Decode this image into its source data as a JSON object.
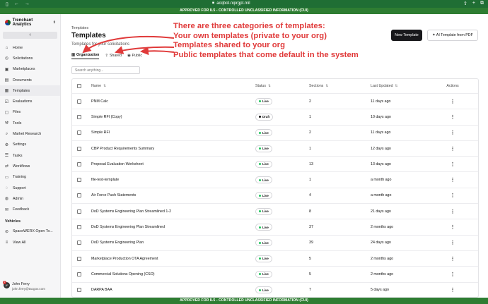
{
  "browser": {
    "url": "acqbot.niprgpt.mil",
    "banner": "APPROVED FOR IL5 - CONTROLLED UNCLASSIFIED INFORMATION (CUI)"
  },
  "sidebar": {
    "org_name": "Trenchant Analytics",
    "items": [
      {
        "label": "Home",
        "icon": "home-icon",
        "glyph": "⌂"
      },
      {
        "label": "Solicitations",
        "icon": "solicitations-icon",
        "glyph": "◎"
      },
      {
        "label": "Marketplaces",
        "icon": "marketplace-icon",
        "glyph": "▣"
      },
      {
        "label": "Documents",
        "icon": "document-icon",
        "glyph": "▤"
      },
      {
        "label": "Templates",
        "icon": "template-icon",
        "glyph": "▦"
      },
      {
        "label": "Evaluations",
        "icon": "evaluation-icon",
        "glyph": "☑"
      },
      {
        "label": "Files",
        "icon": "file-icon",
        "glyph": "▢"
      },
      {
        "label": "Tools",
        "icon": "tools-icon",
        "glyph": "⚒"
      },
      {
        "label": "Market Research",
        "icon": "research-icon",
        "glyph": "⌕"
      },
      {
        "label": "Settings",
        "icon": "gear-icon",
        "glyph": "⚙"
      },
      {
        "label": "Tasks",
        "icon": "tasks-icon",
        "glyph": "☰"
      },
      {
        "label": "Workflows",
        "icon": "workflow-icon",
        "glyph": "⇄"
      },
      {
        "label": "Training",
        "icon": "training-icon",
        "glyph": "▭"
      },
      {
        "label": "Support",
        "icon": "support-icon",
        "glyph": "◌"
      },
      {
        "label": "Admin",
        "icon": "admin-icon",
        "glyph": "◍"
      },
      {
        "label": "Feedback",
        "icon": "feedback-icon",
        "glyph": "✉"
      }
    ],
    "vehicles_label": "Vehicles",
    "vehicles": [
      {
        "label": "SpaceWERX Open To...",
        "icon": "vehicle-icon",
        "glyph": "⊘"
      },
      {
        "label": "View All",
        "icon": "list-icon",
        "glyph": "≡"
      }
    ],
    "user": {
      "name": "John Ferry",
      "email": "john.ferry@tacgov.com",
      "initials": "JF",
      "notifications": "2"
    }
  },
  "page": {
    "breadcrumb": "Templates",
    "title": "Templates",
    "subtitle": "Templates for your solicitations",
    "new_button": "New Template",
    "ai_button": "AI Template from PDF",
    "tabs": [
      {
        "label": "Organization",
        "glyph": "▥"
      },
      {
        "label": "Shared",
        "glyph": "⇪"
      },
      {
        "label": "Public",
        "glyph": "◉"
      }
    ],
    "search_placeholder": "Search anything..."
  },
  "table": {
    "columns": {
      "name": "Name",
      "status": "Status",
      "sections": "Sections",
      "updated": "Last Updated",
      "actions": "Actions"
    },
    "rows": [
      {
        "name": "PNM Calc",
        "status": "Live",
        "sections": "2",
        "updated": "11 days ago"
      },
      {
        "name": "Simple RFI (Copy)",
        "status": "Draft",
        "sections": "1",
        "updated": "10 days ago"
      },
      {
        "name": "Simple RFI",
        "status": "Live",
        "sections": "2",
        "updated": "11 days ago"
      },
      {
        "name": "CBP Product Requirements Summary",
        "status": "Live",
        "sections": "1",
        "updated": "12 days ago"
      },
      {
        "name": "Proposal Evaluation Worksheet",
        "status": "Live",
        "sections": "13",
        "updated": "13 days ago"
      },
      {
        "name": "file-test-template",
        "status": "Live",
        "sections": "1",
        "updated": "a month ago"
      },
      {
        "name": "Air Force Push Statements",
        "status": "Live",
        "sections": "4",
        "updated": "a month ago"
      },
      {
        "name": "DoD Systems Engineering Plan Streamlined 1-2",
        "status": "Live",
        "sections": "8",
        "updated": "21 days ago"
      },
      {
        "name": "DoD Systems Engineering Plan Streamlined",
        "status": "Live",
        "sections": "37",
        "updated": "2 months ago"
      },
      {
        "name": "DoD Systems Engineering Plan",
        "status": "Live",
        "sections": "39",
        "updated": "24 days ago"
      },
      {
        "name": "Marketplace Production OTA Agreement",
        "status": "Live",
        "sections": "5",
        "updated": "2 months ago"
      },
      {
        "name": "Commercial Solutions Opening (CSO)",
        "status": "Live",
        "sections": "5",
        "updated": "2 months ago"
      },
      {
        "name": "DARPA BAA",
        "status": "Live",
        "sections": "7",
        "updated": "5 days ago"
      }
    ]
  },
  "annotation": {
    "lines": [
      "There are three categories of templates:",
      "Your own templates (private to your org)",
      "Templates shared to your org",
      "Public templates that come default in the system"
    ],
    "color": "#e03a3a"
  },
  "colors": {
    "live": "#22c55e",
    "draft": "#111111",
    "banner": "#2e7d32"
  }
}
